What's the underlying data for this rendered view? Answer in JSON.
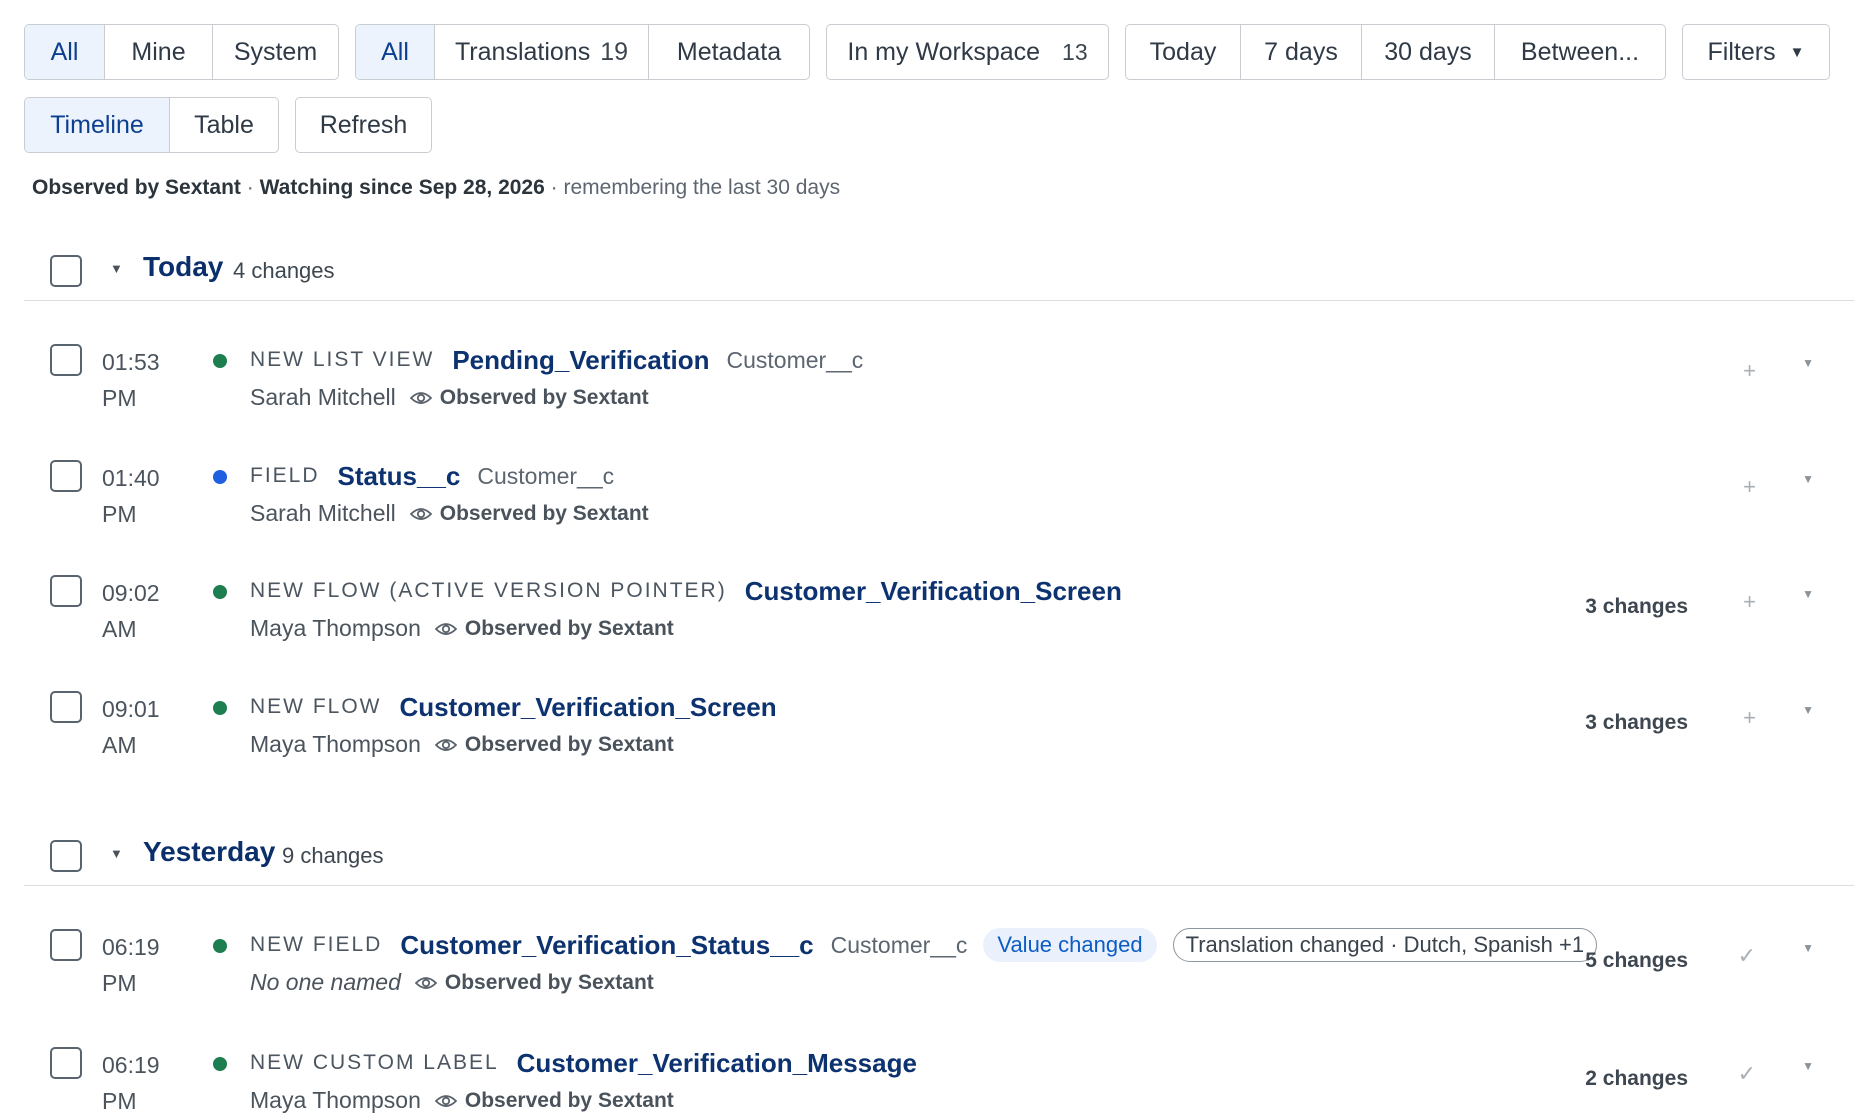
{
  "filters": {
    "owner": [
      "All",
      "Mine",
      "System"
    ],
    "type": [
      {
        "label": "All",
        "count": ""
      },
      {
        "label": "Translations",
        "count": "19"
      },
      {
        "label": "Metadata",
        "count": ""
      }
    ],
    "workspace": {
      "label": "In my Workspace",
      "count": "13"
    },
    "range": [
      "Today",
      "7 days",
      "30 days",
      "Between..."
    ],
    "more": {
      "label": "Filters",
      "caret": "▼"
    }
  },
  "view": {
    "modes": [
      "Timeline",
      "Table"
    ],
    "refresh": "Refresh"
  },
  "meta": {
    "observer": "Observed by Sextant",
    "sep": "·",
    "since": "Watching since Sep 28, 2026",
    "retention": "remembering the last 30 days"
  },
  "groups": [
    {
      "title": "Today",
      "count": "4 changes",
      "rows": [
        {
          "time1": "01:53",
          "time2": "PM",
          "dot": "#1d7f50",
          "kind": "NEW LIST VIEW",
          "name": "Pending_Verification",
          "object": "Customer__c",
          "who": "Sarah Mitchell",
          "observer": "Observed by Sextant",
          "changes": "",
          "action": "+"
        },
        {
          "time1": "01:40",
          "time2": "PM",
          "dot": "#1f5fe0",
          "kind": "FIELD",
          "name": "Status__c",
          "object": "Customer__c",
          "who": "Sarah Mitchell",
          "observer": "Observed by Sextant",
          "changes": "",
          "action": "+"
        },
        {
          "time1": "09:02",
          "time2": "AM",
          "dot": "#1d7f50",
          "kind": "NEW FLOW (ACTIVE VERSION POINTER)",
          "name": "Customer_Verification_Screen",
          "object": "",
          "who": "Maya Thompson",
          "observer": "Observed by Sextant",
          "changes": "3 changes",
          "action": "+"
        },
        {
          "time1": "09:01",
          "time2": "AM",
          "dot": "#1d7f50",
          "kind": "NEW FLOW",
          "name": "Customer_Verification_Screen",
          "object": "",
          "who": "Maya Thompson",
          "observer": "Observed by Sextant",
          "changes": "3 changes",
          "action": "+"
        }
      ]
    },
    {
      "title": "Yesterday",
      "count": "9 changes",
      "rows": [
        {
          "time1": "06:19",
          "time2": "PM",
          "dot": "#1d7f50",
          "kind": "NEW FIELD",
          "name": "Customer_Verification_Status__c",
          "object": "Customer__c",
          "badge1": "Value changed",
          "badge2": "Translation changed · Dutch, Spanish +1",
          "who": "No one named",
          "observer": "Observed by Sextant",
          "changes": "5 changes",
          "action": "✓"
        },
        {
          "time1": "06:19",
          "time2": "PM",
          "dot": "#1d7f50",
          "kind": "NEW CUSTOM LABEL",
          "name": "Customer_Verification_Message",
          "object": "",
          "who": "Maya Thompson",
          "observer": "Observed by Sextant",
          "changes": "2 changes",
          "action": "✓"
        }
      ]
    }
  ],
  "icons": {
    "eye": "eye-icon",
    "more": "chevron-down-icon",
    "collapse": "triangle-down-icon"
  },
  "colors": {
    "accent": "#0d3f91",
    "active_bg": "#edf3fc",
    "dot_green": "#1d7f50",
    "dot_blue": "#1f5fe0"
  }
}
